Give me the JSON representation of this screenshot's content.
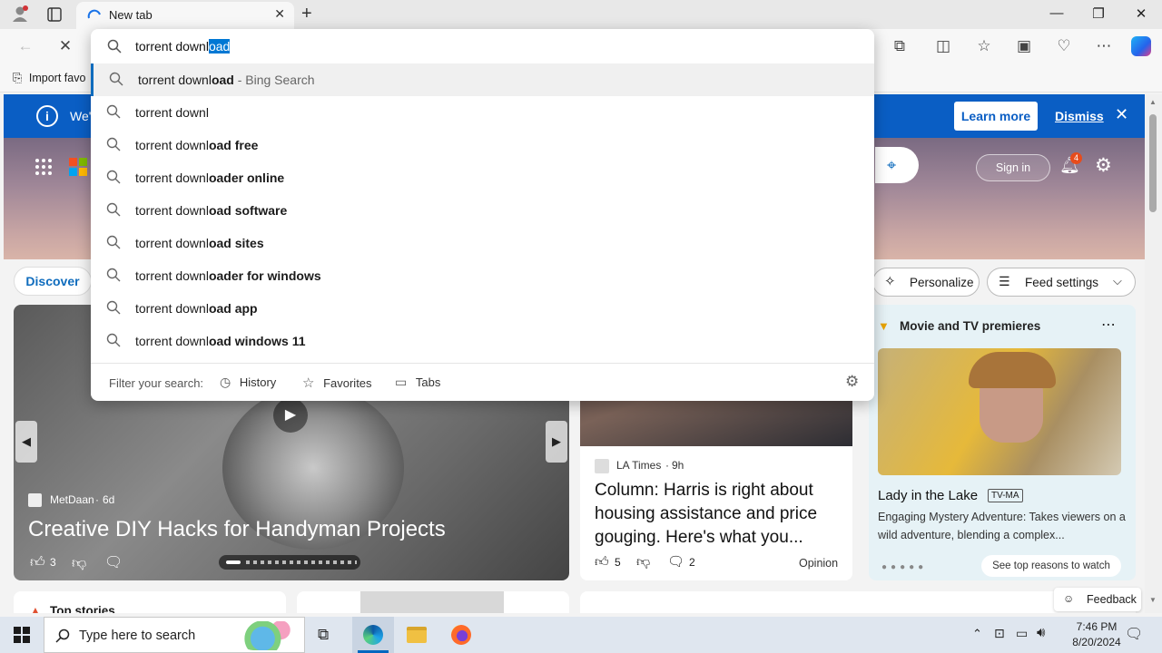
{
  "browser": {
    "tab_title": "New tab",
    "address_value_typed": "torrent downl",
    "address_value_selected": "oad",
    "favorites_bar_item": "Import favo"
  },
  "banner": {
    "text_partial": "We'",
    "learn_more": "Learn more",
    "dismiss": "Dismiss"
  },
  "header": {
    "sign_in": "Sign in",
    "notification_count": "4"
  },
  "feed": {
    "discover_label": "Discover",
    "personalize_label": "Personalize",
    "feed_settings_label": "Feed settings"
  },
  "suggestions": [
    {
      "typed": "torrent downl",
      "rest": "oad",
      "suffix": " - Bing Search"
    },
    {
      "typed": "torrent downl",
      "rest": "",
      "suffix": ""
    },
    {
      "typed": "torrent downl",
      "rest": "oad free",
      "suffix": ""
    },
    {
      "typed": "torrent downl",
      "rest": "oader online",
      "suffix": ""
    },
    {
      "typed": "torrent downl",
      "rest": "oad software",
      "suffix": ""
    },
    {
      "typed": "torrent downl",
      "rest": "oad sites",
      "suffix": ""
    },
    {
      "typed": "torrent downl",
      "rest": "oader for windows",
      "suffix": ""
    },
    {
      "typed": "torrent downl",
      "rest": "oad app",
      "suffix": ""
    },
    {
      "typed": "torrent downl",
      "rest": "oad windows 11",
      "suffix": ""
    }
  ],
  "filter": {
    "label": "Filter your search:",
    "history": "History",
    "favorites": "Favorites",
    "tabs": "Tabs"
  },
  "hero_card": {
    "source": "MetDaan",
    "age": "6d",
    "title": "Creative DIY Hacks for Handyman Projects",
    "likes": "3"
  },
  "news_card": {
    "source": "LA Times",
    "age": "9h",
    "title": "Column: Harris is right about housing assistance and price gouging. Here's what you...",
    "likes": "5",
    "comments": "2",
    "tag": "Opinion"
  },
  "movie_card": {
    "header": "Movie and TV premieres",
    "title": "Lady in the Lake",
    "rating": "TV-MA",
    "desc": "Engaging Mystery Adventure: Takes viewers on a wild adventure, blending a complex...",
    "cta": "See top reasons to watch"
  },
  "bottom": {
    "top_stories": "Top stories",
    "feedback": "Feedback"
  },
  "taskbar": {
    "search_placeholder": "Type here to search",
    "time": "7:46 PM",
    "date": "8/20/2024"
  },
  "colors": {
    "banner_blue": "#0a5ec4",
    "accent_blue": "#0f6cbd",
    "selection_blue": "#0078d4"
  }
}
